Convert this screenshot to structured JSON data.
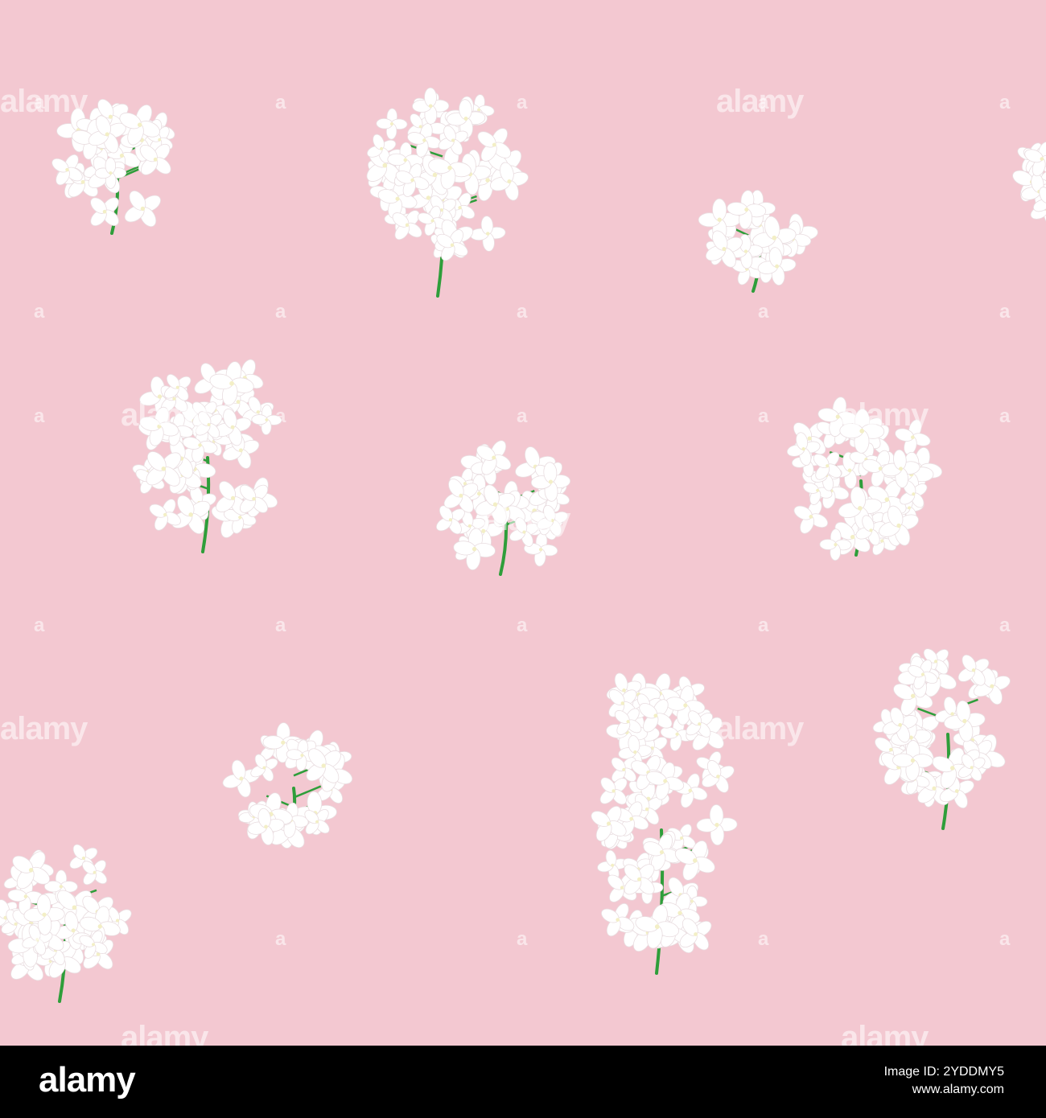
{
  "photo": {
    "description_colors": {
      "background": "#f3c8d1",
      "flower": "#ffffff",
      "stem": "#2e9e3a"
    },
    "watermark_text": "alamy",
    "watermark_glyph": "a"
  },
  "footer": {
    "logo": "alamy",
    "image_id": "Image ID: 2YDDMY5",
    "site": "www.alamy.com"
  }
}
